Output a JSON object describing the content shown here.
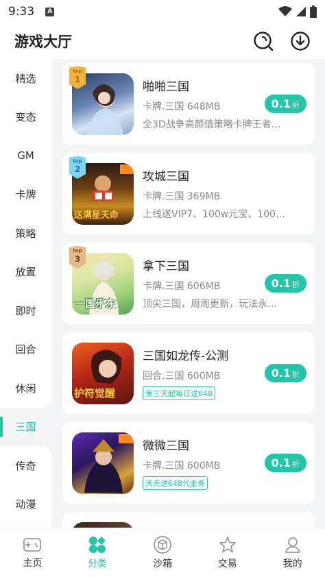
{
  "status_bar": {
    "time": "9:33",
    "sim_label": "A"
  },
  "header": {
    "title": "游戏大厅"
  },
  "sidebar": {
    "items": [
      {
        "label": "精选"
      },
      {
        "label": "变态"
      },
      {
        "label": "GM"
      },
      {
        "label": "卡牌"
      },
      {
        "label": "策略"
      },
      {
        "label": "放置"
      },
      {
        "label": "即时"
      },
      {
        "label": "回合"
      },
      {
        "label": "休闲"
      },
      {
        "label": "三国",
        "active": true
      },
      {
        "label": "传奇"
      },
      {
        "label": "动漫"
      }
    ]
  },
  "games": [
    {
      "name": "啪啪三国",
      "meta": "卡牌.三国 648MB",
      "desc": "全3D战争高颜值策略卡牌王者…",
      "rank_top": "top",
      "rank": "1",
      "discount": "0.1",
      "discount_unit": "折",
      "art_label": ""
    },
    {
      "name": "攻城三国",
      "meta": "卡牌.三国 369MB",
      "desc": "上线送VIP7、100w元宝、100…",
      "rank_top": "top",
      "rank": "2",
      "art_label": "送满星天命"
    },
    {
      "name": "拿下三国",
      "meta": "卡牌.三国 606MB",
      "desc": "顶尖三国，周周更新，玩法永…",
      "rank_top": "top",
      "rank": "3",
      "discount": "0.1",
      "discount_unit": "折",
      "art_label": "一国乐东"
    },
    {
      "name": "三国如龙传-公测",
      "meta": "回合.三国 600MB",
      "tag": "第三天起每日送648",
      "discount": "0.1",
      "discount_unit": "折",
      "art_label": "护符觉醒"
    },
    {
      "name": "微微三国",
      "meta": "卡牌.三国 600MB",
      "tag": "天天送648代金券",
      "discount": "0.1",
      "discount_unit": "折",
      "art_label": ""
    }
  ],
  "bottom_nav": [
    {
      "label": "主页",
      "icon": "gamepad-icon"
    },
    {
      "label": "分类",
      "icon": "category-icon",
      "active": true
    },
    {
      "label": "沙箱",
      "icon": "cube-icon"
    },
    {
      "label": "交易",
      "icon": "star-icon"
    },
    {
      "label": "我的",
      "icon": "user-icon"
    }
  ],
  "colors": {
    "accent": "#22c5a8",
    "rank1": "#f2b33d",
    "rank2": "#5ec8f0",
    "rank3": "#e0a86a"
  }
}
